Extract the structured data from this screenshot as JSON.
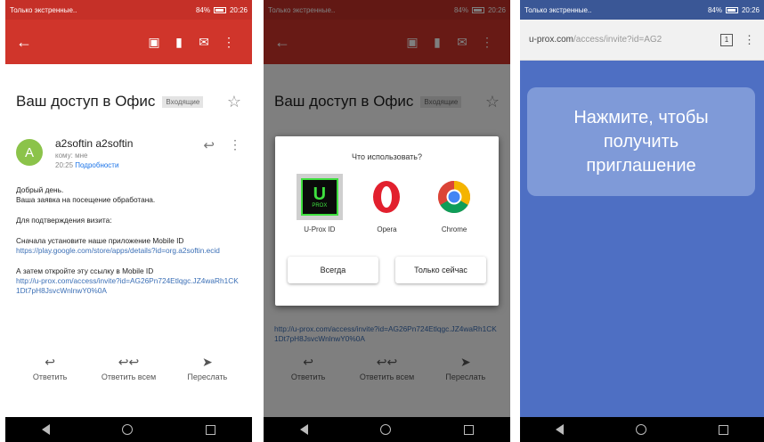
{
  "status": {
    "carrier": "Только экстренные..",
    "battery": "84%",
    "time": "20:26"
  },
  "email": {
    "subject": "Ваш доступ в Офис",
    "label": "Входящие",
    "sender_initial": "A",
    "sender_name": "a2softin a2softin",
    "recipient": "кому: мне",
    "time": "20:25",
    "details_link": "Подробности",
    "greeting": "Добрый день.",
    "line1": "Ваша заявка на посещение обработана.",
    "line2": "Для подтверждения визита:",
    "line3": "Сначала установите наше приложение Mobile ID",
    "store_link": "https://play.google.com/store/apps/details?id=org.a2softin.ecid",
    "line4": "А затем откройте эту ссылку в Mobile ID",
    "invite_link": "http://u-prox.com/access/invite?id=AG26Pn724Etlqgc.JZ4waRh1CK1Dt7pH8JsvcWnlnwY0%0A",
    "actions": [
      {
        "label": "Ответить",
        "icon": "reply-icon"
      },
      {
        "label": "Ответить всем",
        "icon": "reply-all-icon"
      },
      {
        "label": "Переслать",
        "icon": "forward-icon"
      }
    ]
  },
  "dialog": {
    "title": "Что использовать?",
    "apps": [
      {
        "label": "U-Prox ID",
        "icon": "u-prox-icon",
        "selected": true
      },
      {
        "label": "Opera",
        "icon": "opera-icon",
        "selected": false
      },
      {
        "label": "Chrome",
        "icon": "chrome-icon",
        "selected": false
      }
    ],
    "uprox_big": "U",
    "uprox_small": "PROX",
    "always": "Всегда",
    "just_once": "Только сейчас"
  },
  "browser": {
    "url_host": "u-prox.com",
    "url_path": "/access/invite?id=AG2",
    "tab_count": "1",
    "button_text": "Нажмите, чтобы получить приглашение"
  },
  "colors": {
    "gmail_red": "#d0352b",
    "page_blue": "#4e6fc3",
    "button_blue": "#7f9ad8"
  }
}
